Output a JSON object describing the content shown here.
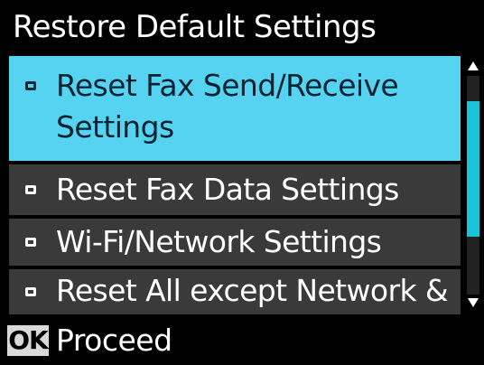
{
  "header": {
    "title": "Restore Default Settings"
  },
  "menu": {
    "items": [
      {
        "label": "Reset Fax Send/Receive Settings",
        "selected": true
      },
      {
        "label": "Reset Fax Data Settings",
        "selected": false
      },
      {
        "label": "Wi-Fi/Network Settings",
        "selected": false
      },
      {
        "label": "Reset All except Network &",
        "selected": false
      }
    ]
  },
  "footer": {
    "ok_label": "OK",
    "action_label": "Proceed"
  },
  "colors": {
    "selected_background": "#56d3f0",
    "item_background": "#3a3a3a",
    "scroll_thumb": "#19c3d8"
  },
  "icons": {
    "scroll_up": "triangle-up-icon",
    "scroll_down": "triangle-down-icon"
  }
}
